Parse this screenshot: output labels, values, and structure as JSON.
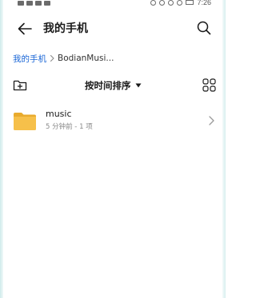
{
  "status_bar": {
    "time": "7:26"
  },
  "header": {
    "title": "我的手机"
  },
  "breadcrumb": {
    "root": "我的手机",
    "current": "BodianMusi..."
  },
  "toolbar": {
    "sort_label": "按时间排序"
  },
  "files": [
    {
      "name": "music",
      "meta": "5 分钟前 - 1 项",
      "icon": "folder-icon"
    }
  ],
  "colors": {
    "accent": "#1a66d6",
    "folder": "#f6c04a",
    "folder_tab": "#e9ab2e"
  }
}
